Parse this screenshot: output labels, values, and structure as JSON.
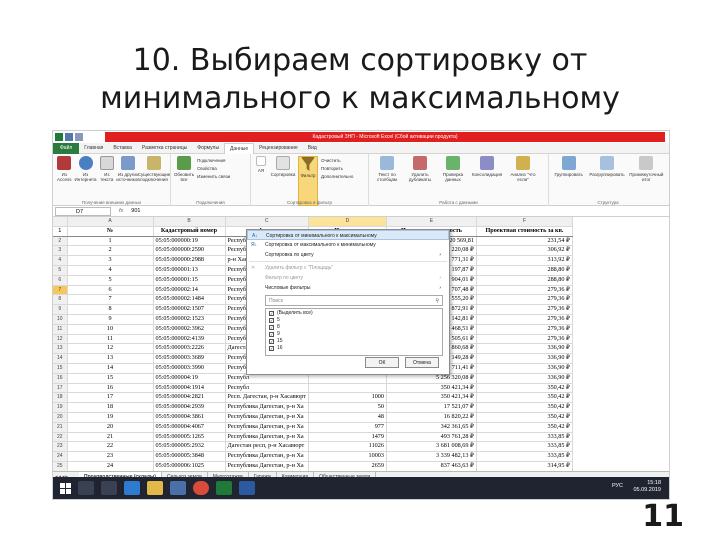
{
  "slide": {
    "title_line1": "10. Выбираем сортировку от",
    "title_line2": "минимального к максимальному",
    "number": "11"
  },
  "excel": {
    "window_title": "Кадастровый ЗНП - Microsoft Excel (Сбой активации продукта)",
    "tabs": [
      "Файл",
      "Главная",
      "Вставка",
      "Разметка страницы",
      "Формулы",
      "Данные",
      "Рецензирование",
      "Вид"
    ],
    "active_tab": "Данные",
    "ribbon": {
      "ext_data": {
        "buttons": [
          "Из Access",
          "Из Интернета",
          "Из текста",
          "Из других источников",
          "Существующие подключения"
        ],
        "label": "Получение внешних данных"
      },
      "connections": {
        "button": "Обновить все",
        "items": [
          "Подключения",
          "Свойства",
          "Изменить связи"
        ],
        "label": "Подключения"
      },
      "sort_filter": {
        "sort_az": "АЯ",
        "sort": "Сортировка",
        "filter": "Фильтр",
        "items": [
          "Очистить",
          "Повторить",
          "Дополнительно"
        ],
        "label": "Сортировка и фильтр"
      },
      "data_tools": {
        "buttons": [
          "Текст по столбцам",
          "Удалить дубликаты",
          "Проверка данных",
          "Консолидация",
          "Анализ \"что если\""
        ],
        "label": "Работа с данными"
      },
      "outline": {
        "buttons": [
          "Группировать",
          "Разгруппировать",
          "Промежуточный итог"
        ],
        "label": "Структура"
      }
    },
    "formula_bar": {
      "cell": "D7",
      "fx": "fx",
      "value": "901"
    },
    "columns": [
      "",
      "A",
      "B",
      "C",
      "D",
      "E",
      "F"
    ],
    "headers": [
      "№",
      "Кадастровый номер",
      "Адрес",
      "Площадь",
      "Проектная стоимость",
      "Проектная стоимость за кв."
    ],
    "selected_row": "7",
    "rows": [
      [
        "2",
        "1",
        "05:05:000000:19",
        "Республ",
        "",
        "20 569,81",
        "231,54 ₽"
      ],
      [
        "3",
        "2",
        "05:05:000000:2590",
        "Республ",
        "",
        "3 069 220,08 ₽",
        "306,92 ₽"
      ],
      [
        "4",
        "3",
        "05:05:000000:2988",
        "р-н Хасав",
        "",
        "1 879 771,31 ₽",
        "313,92 ₽"
      ],
      [
        "5",
        "4",
        "05:05:000001:13",
        "Республ",
        "",
        "1 183 197,87 ₽",
        "288,80 ₽"
      ],
      [
        "6",
        "5",
        "05:05:000001:15",
        "Республ",
        "",
        "7 219 904,01 ₽",
        "288,80 ₽"
      ],
      [
        "7",
        "6",
        "05:05:000002:14",
        "Республ",
        "",
        "251 707,48 ₽",
        "279,36 ₽"
      ],
      [
        "8",
        "7",
        "05:05:000002:1484",
        "Республ",
        "",
        "195 555,20 ₽",
        "279,36 ₽"
      ],
      [
        "9",
        "8",
        "05:05:000002:1507",
        "Республ",
        "",
        "55 872,91 ₽",
        "279,36 ₽"
      ],
      [
        "10",
        "9",
        "05:05:000002:1523",
        "Республ",
        "",
        "25 142,81 ₽",
        "279,36 ₽"
      ],
      [
        "11",
        "10",
        "05:05:000002:3962",
        "Республ",
        "",
        "4 190 468,51 ₽",
        "279,36 ₽"
      ],
      [
        "12",
        "11",
        "05:05:000002:4139",
        "Республ",
        "",
        "1 272 505,61 ₽",
        "279,36 ₽"
      ],
      [
        "13",
        "12",
        "05:05:000003:2226",
        "Дагестан",
        "",
        "1 025 860,68 ₽",
        "336,90 ₽"
      ],
      [
        "14",
        "13",
        "05:05:000003:3689",
        "Республ",
        "",
        "990 149,28 ₽",
        "336,90 ₽"
      ],
      [
        "15",
        "14",
        "05:05:000003:3990",
        "Республ",
        "",
        "35 711,41 ₽",
        "336,90 ₽"
      ],
      [
        "16",
        "15",
        "05:05:000004:19",
        "Республ",
        "",
        "5 256 320,08 ₽",
        "336,90 ₽"
      ],
      [
        "17",
        "16",
        "05:05:000004:1914",
        "Республ",
        "",
        "350 421,34 ₽",
        "350,42 ₽"
      ],
      [
        "18",
        "17",
        "05:05:000004:2821",
        "Респ. Дагестан, р-н Хасавюрт",
        "1000",
        "350 421,34 ₽",
        "350,42 ₽"
      ],
      [
        "19",
        "18",
        "05:05:000004:2939",
        "Республика Дагестан, р-н Ха",
        "50",
        "17 521,07 ₽",
        "350,42 ₽"
      ],
      [
        "20",
        "19",
        "05:05:000004:3861",
        "Республика Дагестан, р-н Ха",
        "48",
        "16 820,22 ₽",
        "350,42 ₽"
      ],
      [
        "21",
        "20",
        "05:05:000004:4067",
        "Республика Дагестан, р-н Ха",
        "977",
        "342 361,65 ₽",
        "350,42 ₽"
      ],
      [
        "22",
        "21",
        "05:05:000005:1265",
        "Республика Дагестан, р-н Ха",
        "1479",
        "493 761,28 ₽",
        "333,85 ₽"
      ],
      [
        "23",
        "22",
        "05:05:000005:2932",
        "Дагестан респ, р-н Хасавюрт",
        "11026",
        "3 681 008,69 ₽",
        "333,85 ₽"
      ],
      [
        "24",
        "23",
        "05:05:000005:3848",
        "Республика Дагестан, р-н Ха",
        "10003",
        "3 339 482,13 ₽",
        "333,85 ₽"
      ],
      [
        "25",
        "24",
        "05:05:000006:1025",
        "Республика Дагестан, р-н Ха",
        "2659",
        "837 463,63 ₽",
        "314,95 ₽"
      ],
      [
        "26",
        "25",
        "05:05:000006:1028",
        "Республика Дагестан, р-н Ха",
        "19999",
        "6 298 772,14 ₽",
        "314,95 ₽"
      ]
    ],
    "filter_menu": {
      "sort_asc": "Сортировка от минимального к максимальному",
      "sort_desc": "Сортировка от максимального к минимальному",
      "sort_color": "Сортировка по цвету",
      "clear": "Удалить фильтр с \"Площадь\"",
      "filter_color": "Фильтр по цвету",
      "number_filters": "Числовые фильтры",
      "search_placeholder": "Поиск",
      "values": [
        "(Выделить все)",
        "5",
        "8",
        "9",
        "15",
        "16"
      ],
      "ok": "ОК",
      "cancel": "Отмена"
    },
    "sheets": [
      "Производственные (склады)",
      "Сельхоз земли",
      "Многоэтажки",
      "Гаражи",
      "Коммерция",
      "Общественные земли"
    ],
    "active_sheet": "Производственные (склады)",
    "status": "Готово"
  },
  "taskbar": {
    "lang": "РУС",
    "time": "15:18",
    "date": "05.09.2019"
  }
}
